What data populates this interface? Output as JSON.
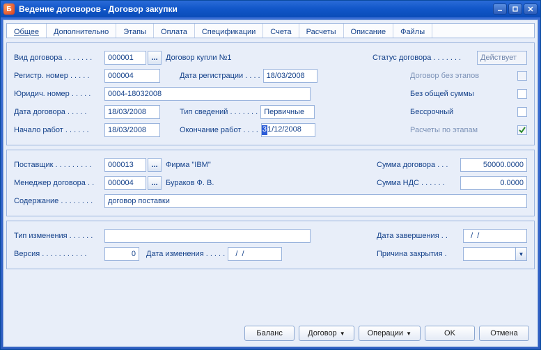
{
  "window_title": "Ведение договоров - Договор закупки",
  "tabs": [
    "Общее",
    "Дополнительно",
    "Этапы",
    "Оплата",
    "Спецификации",
    "Счета",
    "Расчеты",
    "Описание",
    "Файлы"
  ],
  "labels": {
    "contract_type": "Вид договора . . . . . . .",
    "reg_number": "Регистр. номер . . . . .",
    "legal_number": "Юридич. номер . . . . .",
    "contract_date": "Дата договора . . . . .",
    "work_start": "Начало работ . . . . . .",
    "reg_date": "Дата регистрации . . . .",
    "info_type": "Тип сведений . . . . . . .",
    "work_end": "Окончание работ . . . .",
    "status": "Статус договора . . . . . . .",
    "no_stages": "Договор без этапов",
    "no_total": "Без общей суммы",
    "unlimited": "Бессрочный",
    "calc_by_stages": "Расчеты по этапам",
    "supplier": "Поставщик . . . . . . . . .",
    "manager": "Менеджер договора . .",
    "content": "Содержание . . . . . . . .",
    "contract_sum": "Сумма договора . . .",
    "vat_sum": "Сумма НДС . . . . . .",
    "change_type": "Тип изменения . . . . . .",
    "version": "Версия . . . . . . . . . . .",
    "change_date": "Дата изменения . . . . .",
    "complete_date": "Дата завершения . .",
    "close_reason": "Причина закрытия ."
  },
  "values": {
    "contract_type_code": "000001",
    "contract_type_name": "Договор купли №1",
    "reg_number": "000004",
    "legal_number": "0004-18032008",
    "contract_date": "18/03/2008",
    "work_start": "18/03/2008",
    "reg_date": "18/03/2008",
    "info_type": "Первичные",
    "work_end": "31/12/2008",
    "status": "Действует",
    "supplier_code": "000013",
    "supplier_name": "Фирма \"IBM\"",
    "manager_code": "000004",
    "manager_name": "Бураков Ф. В.",
    "content": "договор поставки",
    "contract_sum": "50000.0000",
    "vat_sum": "0.0000",
    "change_type": "",
    "version": "0",
    "change_date": "  /  /",
    "complete_date": "  /  /",
    "close_reason": ""
  },
  "checks": {
    "no_stages": false,
    "no_total": false,
    "unlimited": false,
    "calc_by_stages": true
  },
  "buttons": {
    "balance": "Баланс",
    "contract": "Договор",
    "operations": "Операции",
    "ok": "OK",
    "cancel": "Отмена"
  },
  "lookup": "..."
}
